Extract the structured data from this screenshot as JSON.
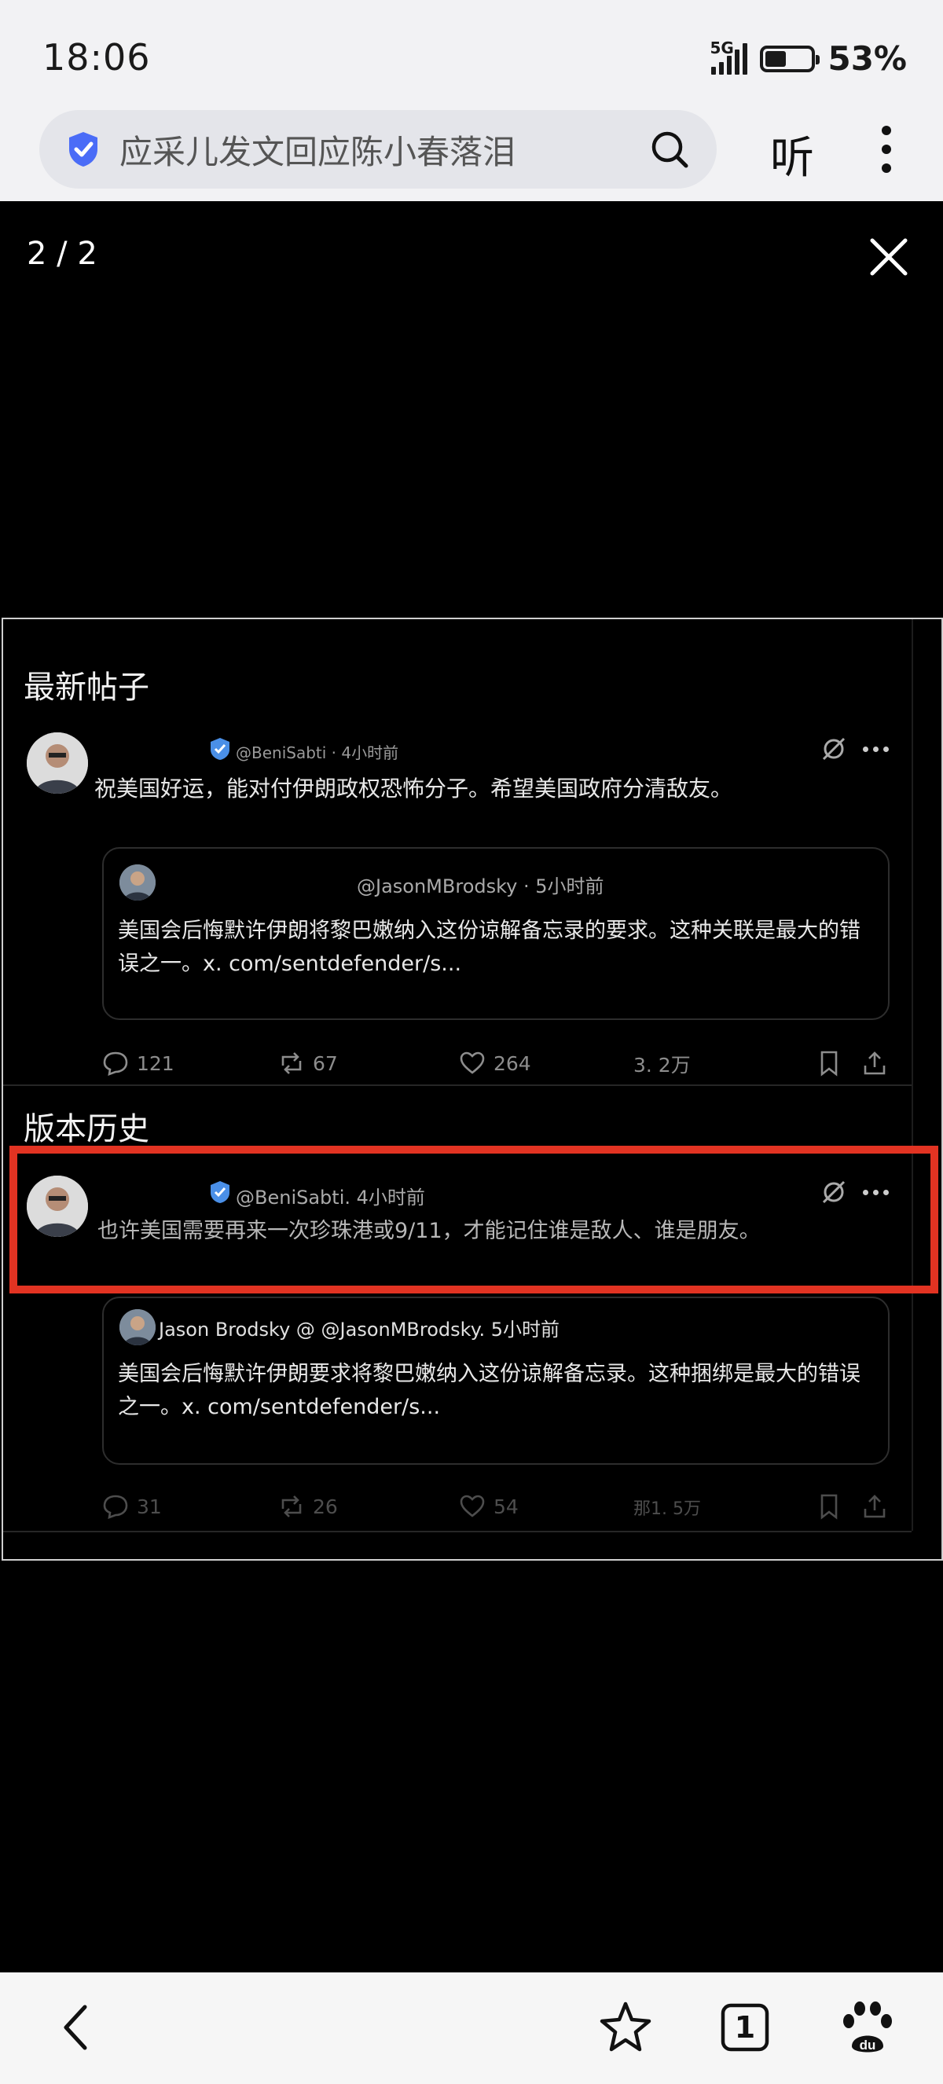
{
  "status_bar": {
    "time": "18:06",
    "network": "5G",
    "battery_percent": "53%",
    "battery_level": 0.45
  },
  "browser": {
    "search_text": "应采儿发文回应陈小春落泪",
    "listen_label": "听",
    "icons": [
      "shield-verified-icon",
      "search-icon",
      "more-vertical-icon"
    ]
  },
  "viewer": {
    "counter": "2 / 2",
    "close_icon": "close-icon"
  },
  "post_screenshot": {
    "latest_section": {
      "title": "最新帖子",
      "post": {
        "handle": "@BeniSabti · 4小时前",
        "text": "祝美国好运，能对付伊朗政权恐怖分子。希望美国政府分清敌友。",
        "quote": {
          "handle": "@JasonMBrodsky · 5小时前",
          "line1": "美国会后悔默许伊朗将黎巴嫩纳入这份谅解备忘录的要求。这种关联是最大的错",
          "line2": "误之一。x. com/sentdefender/s..."
        },
        "stats": {
          "replies": "121",
          "reposts": "67",
          "likes": "264",
          "views": "3. 2万"
        }
      }
    },
    "history_section": {
      "title": "版本历史",
      "post": {
        "handle": "@BeniSabti. 4小时前",
        "text": "也许美国需要再来一次珍珠港或9/11，才能记住谁是敌人、谁是朋友。",
        "quote": {
          "author": "Jason Brodsky @ @JasonMBrodsky. 5小时前",
          "line1": "美国会后悔默许伊朗要求将黎巴嫩纳入这份谅解备忘录。这种捆绑是最大的错误",
          "line2": "之一。x. com/sentdefender/s..."
        },
        "stats": {
          "replies": "31",
          "reposts": "26",
          "likes": "54",
          "views": "那1. 5万"
        }
      }
    },
    "highlight_color": "#e23322"
  },
  "bottom_nav": {
    "tab_count": "1",
    "icons": [
      "back-icon",
      "star-icon",
      "tabs-icon",
      "baidu-paw-icon"
    ]
  }
}
